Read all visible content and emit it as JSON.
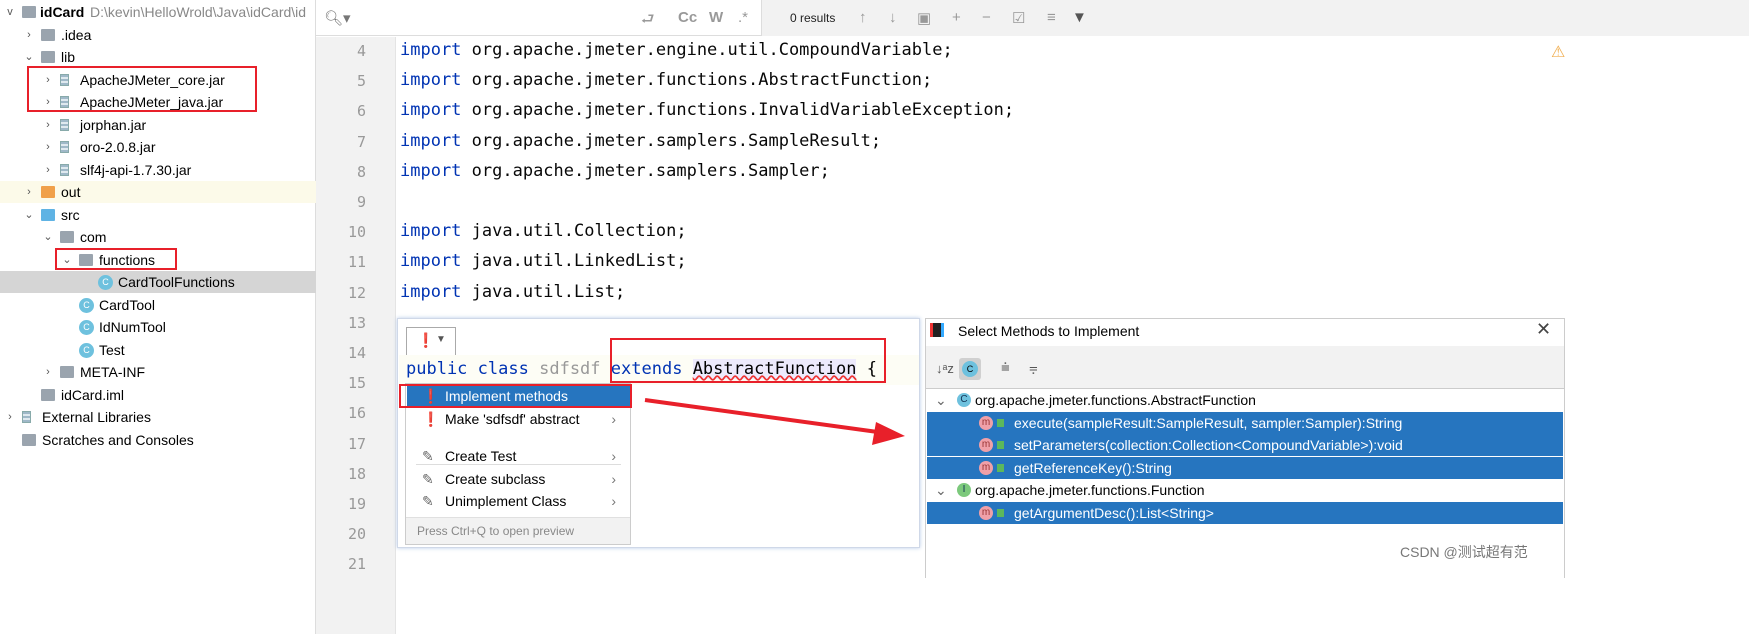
{
  "project": {
    "name": "idCard",
    "path": "D:\\kevin\\HelloWrold\\Java\\idCard\\id",
    "tree": [
      {
        "label": ".idea",
        "indent": 1,
        "arrow": ">",
        "icon": "folder-icon"
      },
      {
        "label": "lib",
        "indent": 1,
        "arrow": "v",
        "icon": "folder-icon"
      },
      {
        "label": "ApacheJMeter_core.jar",
        "indent": 2,
        "arrow": ">",
        "icon": "jar-icon"
      },
      {
        "label": "ApacheJMeter_java.jar",
        "indent": 2,
        "arrow": ">",
        "icon": "jar-icon"
      },
      {
        "label": "jorphan.jar",
        "indent": 2,
        "arrow": ">",
        "icon": "jar-icon"
      },
      {
        "label": "oro-2.0.8.jar",
        "indent": 2,
        "arrow": ">",
        "icon": "jar-icon"
      },
      {
        "label": "slf4j-api-1.7.30.jar",
        "indent": 2,
        "arrow": ">",
        "icon": "jar-icon"
      },
      {
        "label": "out",
        "indent": 1,
        "arrow": ">",
        "icon": "folder-orange-icon"
      },
      {
        "label": "src",
        "indent": 1,
        "arrow": "v",
        "icon": "folder-blue-icon"
      },
      {
        "label": "com",
        "indent": 2,
        "arrow": "v",
        "icon": "package-icon"
      },
      {
        "label": "functions",
        "indent": 3,
        "arrow": "v",
        "icon": "package-icon"
      },
      {
        "label": "CardToolFunctions",
        "indent": 4,
        "arrow": "",
        "icon": "class-icon"
      },
      {
        "label": "CardTool",
        "indent": 3,
        "arrow": "",
        "icon": "class-icon"
      },
      {
        "label": "IdNumTool",
        "indent": 3,
        "arrow": "",
        "icon": "class-icon"
      },
      {
        "label": "Test",
        "indent": 3,
        "arrow": "",
        "icon": "class-icon"
      },
      {
        "label": "META-INF",
        "indent": 2,
        "arrow": ">",
        "icon": "folder-icon"
      },
      {
        "label": "idCard.iml",
        "indent": 1,
        "arrow": "",
        "icon": "iml-icon"
      },
      {
        "label": "External Libraries",
        "indent": 0,
        "arrow": ">",
        "icon": "library-icon"
      },
      {
        "label": "Scratches and Consoles",
        "indent": 0,
        "arrow": "",
        "icon": "scratches-icon"
      }
    ]
  },
  "search": {
    "results": "0 results",
    "match_case": "Cc",
    "words": "W",
    "regex": ".*"
  },
  "code": [
    {
      "n": "4",
      "kw": "import",
      "rest": " org.apache.jmeter.engine.util.CompoundVariable;"
    },
    {
      "n": "5",
      "kw": "import",
      "rest": " org.apache.jmeter.functions.AbstractFunction;"
    },
    {
      "n": "6",
      "kw": "import",
      "rest": " org.apache.jmeter.functions.InvalidVariableException;"
    },
    {
      "n": "7",
      "kw": "import",
      "rest": " org.apache.jmeter.samplers.SampleResult;"
    },
    {
      "n": "8",
      "kw": "import",
      "rest": " org.apache.jmeter.samplers.Sampler;"
    },
    {
      "n": "9",
      "kw": "",
      "rest": ""
    },
    {
      "n": "10",
      "kw": "import",
      "rest": " java.util.Collection;"
    },
    {
      "n": "11",
      "kw": "import",
      "rest": " java.util.LinkedList;"
    },
    {
      "n": "12",
      "kw": "import",
      "rest": " java.util.List;"
    },
    {
      "n": "13",
      "kw": "",
      "rest": ""
    },
    {
      "n": "14",
      "kw": "",
      "rest": ""
    },
    {
      "n": "15",
      "kw": "",
      "rest": ""
    },
    {
      "n": "16",
      "kw": "",
      "rest": ""
    },
    {
      "n": "17",
      "kw": "",
      "rest": ""
    },
    {
      "n": "18",
      "kw": "",
      "rest": ""
    },
    {
      "n": "19",
      "kw": "",
      "rest": ""
    },
    {
      "n": "20",
      "kw": "",
      "rest": ""
    },
    {
      "n": "21",
      "kw": "",
      "rest": ""
    }
  ],
  "class_line": {
    "public": "public",
    "class": "class",
    "name": "sdfsdf",
    "extends": "extends",
    "super": "AbstractFunction",
    "brace": "{"
  },
  "intention_menu": {
    "items": [
      {
        "label": "Implement methods",
        "sub": false
      },
      {
        "label": "Make 'sdfsdf' abstract",
        "sub": true
      },
      {
        "label": "Create Test",
        "sub": true
      },
      {
        "label": "Create subclass",
        "sub": true
      },
      {
        "label": "Unimplement Class",
        "sub": true
      }
    ],
    "hint": "Press Ctrl+Q to open preview"
  },
  "dialog": {
    "title": "Select Methods to Implement",
    "groups": [
      {
        "name": "org.apache.jmeter.functions.AbstractFunction",
        "type": "C",
        "methods": [
          "execute(sampleResult:SampleResult, sampler:Sampler):String",
          "setParameters(collection:Collection<CompoundVariable>):void",
          "getReferenceKey():String"
        ]
      },
      {
        "name": "org.apache.jmeter.functions.Function",
        "type": "I",
        "methods": [
          "getArgumentDesc():List<String>"
        ]
      }
    ]
  },
  "watermark": "CSDN @测试超有范",
  "colors": {
    "selection": "#2675bf",
    "annotation": "#e8202a"
  }
}
